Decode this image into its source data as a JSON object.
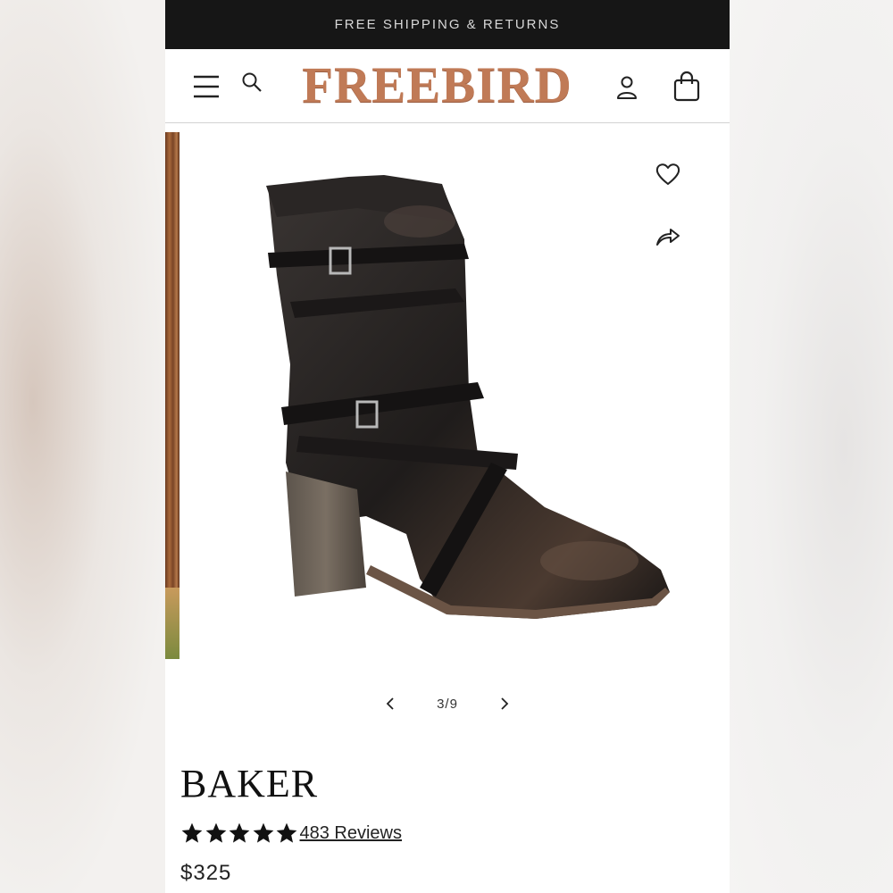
{
  "promo": {
    "text": "FREE SHIPPING & RETURNS"
  },
  "header": {
    "logo_text": "FREEBIRD",
    "icons": [
      "menu-icon",
      "search-icon",
      "account-icon",
      "shopping-bag-icon"
    ]
  },
  "gallery": {
    "current_slide": 3,
    "total_slides": 9,
    "counter_text": "3/9",
    "action_icons": [
      "heart-icon",
      "share-icon"
    ]
  },
  "product": {
    "name": "BAKER",
    "rating": 5,
    "reviews_text": "483 Reviews",
    "price": "$325"
  },
  "colors": {
    "promo_bg": "#161616",
    "logo": "#c07a56",
    "text": "#111111"
  }
}
